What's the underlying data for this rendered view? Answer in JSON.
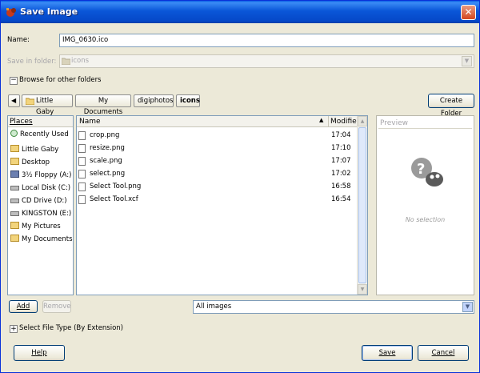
{
  "window": {
    "title": "Save Image"
  },
  "name_field": {
    "label": "Name:",
    "value": "IMG_0630.ico"
  },
  "save_in": {
    "label": "Save in folder:",
    "value": "icons"
  },
  "browse": {
    "label": "Browse for other folders"
  },
  "path_bar": {
    "crumbs": [
      "Little Gaby",
      "My Documents",
      "digiphotos",
      "icons"
    ]
  },
  "create_folder": {
    "label": "Create Folder"
  },
  "places": {
    "header": "Places",
    "items": [
      "Recently Used",
      "Little Gaby",
      "Desktop",
      "3½ Floppy (A:)",
      "Local Disk (C:)",
      "CD Drive (D:)",
      "KINGSTON (E:)",
      "My Pictures",
      "My Documents"
    ]
  },
  "files": {
    "col_name": "Name",
    "col_modified": "Modified",
    "rows": [
      {
        "name": "crop.png",
        "modified": "17:04"
      },
      {
        "name": "resize.png",
        "modified": "17:10"
      },
      {
        "name": "scale.png",
        "modified": "17:07"
      },
      {
        "name": "select.png",
        "modified": "17:02"
      },
      {
        "name": "Select Tool.png",
        "modified": "16:58"
      },
      {
        "name": "Select Tool.xcf",
        "modified": "16:54"
      }
    ]
  },
  "preview": {
    "header": "Preview",
    "empty": "No selection"
  },
  "add": {
    "label": "Add"
  },
  "remove": {
    "label": "Remove"
  },
  "filter": {
    "value": "All images"
  },
  "file_type": {
    "label": "Select File Type (By Extension)"
  },
  "help": {
    "label": "Help"
  },
  "save": {
    "label": "Save"
  },
  "cancel": {
    "label": "Cancel"
  },
  "colors": {
    "titlebar": "#0a56d8",
    "window_bg": "#ece9d8",
    "selected_place": "#316ac5"
  }
}
